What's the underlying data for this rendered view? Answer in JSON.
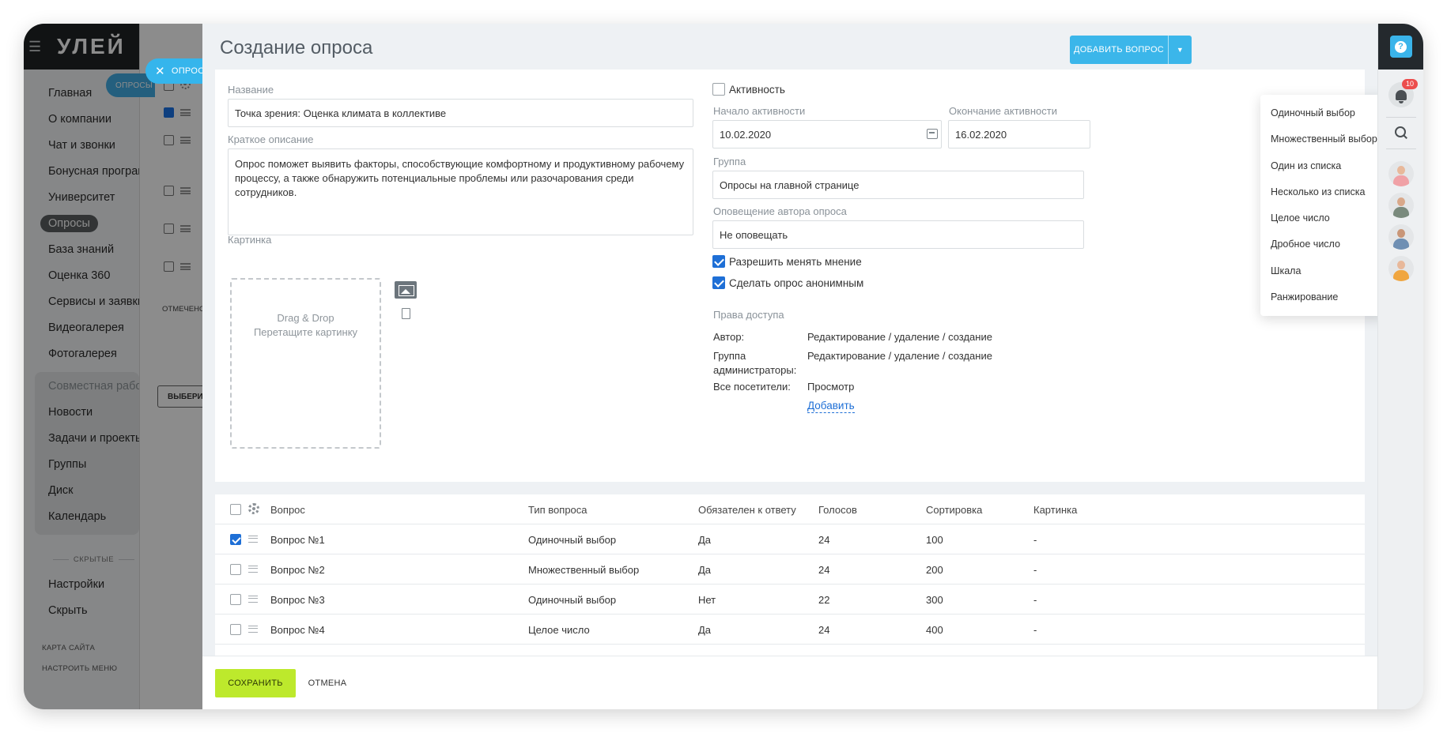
{
  "sidebar": {
    "logo": "УЛЕЙ",
    "items": [
      {
        "label": "Главная"
      },
      {
        "label": "О компании"
      },
      {
        "label": "Чат и звонки"
      },
      {
        "label": "Бонусная программа"
      },
      {
        "label": "Университет"
      },
      {
        "label": "Опросы"
      },
      {
        "label": "База знаний"
      },
      {
        "label": "Оценка 360"
      },
      {
        "label": "Сервисы и заявки"
      },
      {
        "label": "Видеогалерея"
      },
      {
        "label": "Фотогалерея"
      }
    ],
    "group": [
      {
        "label": "Совместная работа"
      },
      {
        "label": "Новости"
      },
      {
        "label": "Задачи и проекты"
      },
      {
        "label": "Группы"
      },
      {
        "label": "Диск"
      },
      {
        "label": "Календарь"
      }
    ],
    "hidden_label": "СКРЫТЫЕ",
    "settings": "Настройки",
    "hide": "Скрыть",
    "site_map": "КАРТА САЙТА",
    "configure_menu": "НАСТРОИТЬ МЕНЮ"
  },
  "behind": {
    "tab_label": "ОПРОСЫ",
    "marked": "ОТМЕЧЕНО",
    "select_button": "ВЫБЕРИТЕ"
  },
  "close_tab": {
    "label": "ОПРОС"
  },
  "panel": {
    "title": "Создание опроса",
    "add_question_button": "ДОБАВИТЬ ВОПРОС",
    "add_question_arrow": "▼"
  },
  "form": {
    "name_label": "Название",
    "name_value": "Точка зрения: Оценка климата в коллективе",
    "desc_label": "Краткое описание",
    "desc_value": "Опрос поможет выявить факторы, способствующие комфортному и продуктивному рабочему процессу, а также обнаружить потенциальные проблемы или разочарования среди сотрудников.",
    "image_label": "Картинка",
    "dropzone_line1": "Drag & Drop",
    "dropzone_line2": "Перетащите картинку",
    "active_label": "Активность",
    "active_checked": false,
    "start_label": "Начало активности",
    "start_value": "10.02.2020",
    "end_label": "Окончание активности",
    "end_value": "16.02.2020",
    "group_label": "Группа",
    "group_value": "Опросы на главной странице",
    "notify_label": "Оповещение автора опроса",
    "notify_value": "Не оповещать",
    "allow_change_label": "Разрешить менять мнение",
    "allow_change_checked": true,
    "anonymous_label": "Сделать опрос анонимным",
    "anonymous_checked": true,
    "access_title": "Права доступа",
    "access": [
      {
        "role": "Автор:",
        "rights": "Редактирование / удаление / создание"
      },
      {
        "role": "Группа администраторы:",
        "rights": "Редактирование / удаление / создание"
      },
      {
        "role": "Все посетители:",
        "rights": "Просмотр"
      }
    ],
    "access_add": "Добавить"
  },
  "table": {
    "columns": [
      "Вопрос",
      "Тип вопроса",
      "Обязателен к ответу",
      "Голосов",
      "Сортировка",
      "Картинка"
    ],
    "rows": [
      {
        "checked": true,
        "question": "Вопрос №1",
        "type": "Одиночный выбор",
        "required": "Да",
        "votes": "24",
        "sort": "100",
        "image": "-"
      },
      {
        "checked": false,
        "question": "Вопрос №2",
        "type": "Множественный выбор",
        "required": "Да",
        "votes": "24",
        "sort": "200",
        "image": "-"
      },
      {
        "checked": false,
        "question": "Вопрос №3",
        "type": "Одиночный выбор",
        "required": "Нет",
        "votes": "22",
        "sort": "300",
        "image": "-"
      },
      {
        "checked": false,
        "question": "Вопрос №4",
        "type": "Целое число",
        "required": "Да",
        "votes": "24",
        "sort": "400",
        "image": "-"
      }
    ]
  },
  "footer": {
    "save": "СОХРАНИТЬ",
    "cancel": "ОТМЕНА"
  },
  "dropdown": {
    "items": [
      "Одиночный выбор",
      "Множественный выбор",
      "Один из списка",
      "Несколько из списка",
      "Целое число",
      "Дробное число",
      "Шкала",
      "Ранжирование"
    ]
  },
  "rail": {
    "help": "?",
    "notifications_count": "10"
  },
  "colors": {
    "accent": "#3bb6ea",
    "save": "#bde92c",
    "checkbox": "#1e6fd6",
    "badge": "#ec4d4d"
  }
}
